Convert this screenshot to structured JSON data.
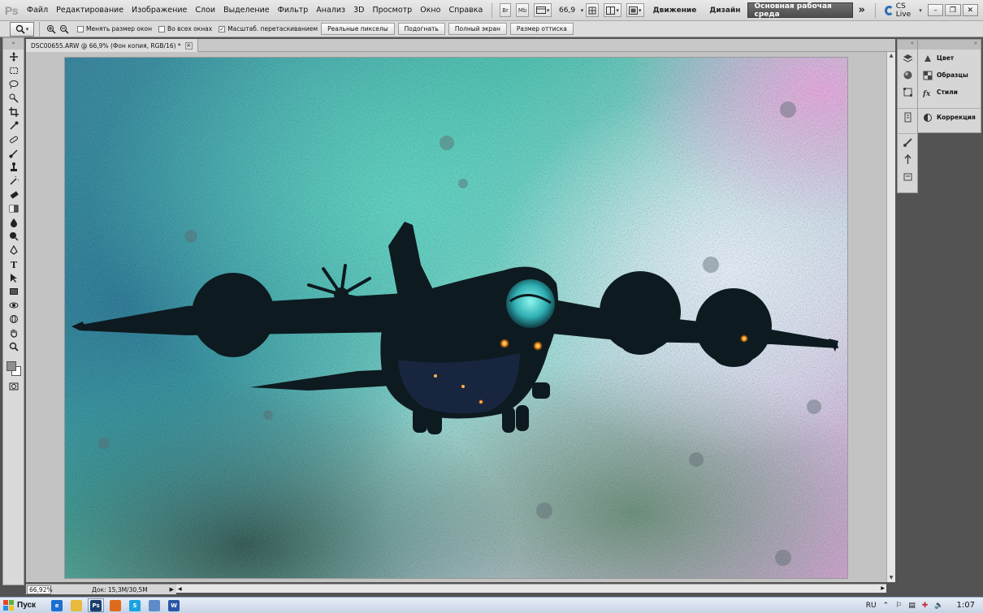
{
  "app": {
    "logo": "Ps"
  },
  "menu": {
    "items": [
      "Файл",
      "Редактирование",
      "Изображение",
      "Слои",
      "Выделение",
      "Фильтр",
      "Анализ",
      "3D",
      "Просмотр",
      "Окно",
      "Справка"
    ],
    "zoom_value": "66,9",
    "br_label": "Br",
    "mb_label": "Mb",
    "workspaces": [
      "Движение",
      "Дизайн"
    ],
    "active_workspace": "Основная рабочая среда",
    "more": "»",
    "cs_live": "CS Live",
    "win_min": "–",
    "win_restore": "❐",
    "win_close": "✕"
  },
  "options": {
    "checkboxes": [
      {
        "label": "Менять размер окон",
        "checked": false
      },
      {
        "label": "Во всех окнах",
        "checked": false
      },
      {
        "label": "Масштаб. перетаскиванием",
        "checked": true
      }
    ],
    "buttons": [
      "Реальные пикселы",
      "Подогнать",
      "Полный экран",
      "Размер оттиска"
    ],
    "check_mark": "✓"
  },
  "document": {
    "tab_title": "DSC00655.ARW @ 66,9% (Фон копия, RGB/16) *",
    "tab_close": "×"
  },
  "status": {
    "zoom": "66,92%",
    "doc_info": "Док: 15,3M/30,5M",
    "arrow": "▶"
  },
  "panels": {
    "group1": [
      "Цвет",
      "Образцы",
      "Стили"
    ],
    "group2": [
      "Коррекция"
    ]
  },
  "taskbar": {
    "start": "Пуск",
    "apps": [
      {
        "name": "ie-app",
        "letter": "e",
        "color": "#1c6fd1",
        "active": false
      },
      {
        "name": "explorer-app",
        "letter": "",
        "color": "#e8b93b",
        "active": false
      },
      {
        "name": "photoshop-app",
        "letter": "Ps",
        "color": "#1a3d6d",
        "active": true
      },
      {
        "name": "firefox-app",
        "letter": "",
        "color": "#e06a1b",
        "active": false
      },
      {
        "name": "skype-app",
        "letter": "S",
        "color": "#1aa3e0",
        "active": false
      },
      {
        "name": "window-app",
        "letter": "",
        "color": "#5f8cc6",
        "active": false
      },
      {
        "name": "word-app",
        "letter": "W",
        "color": "#2b56a6",
        "active": false
      }
    ],
    "lang": "RU",
    "time": "1:07"
  },
  "colors": {
    "foreground": "#8f8f8f",
    "background": "#ffffff",
    "active_workspace_bg": "#4d4d4d"
  }
}
